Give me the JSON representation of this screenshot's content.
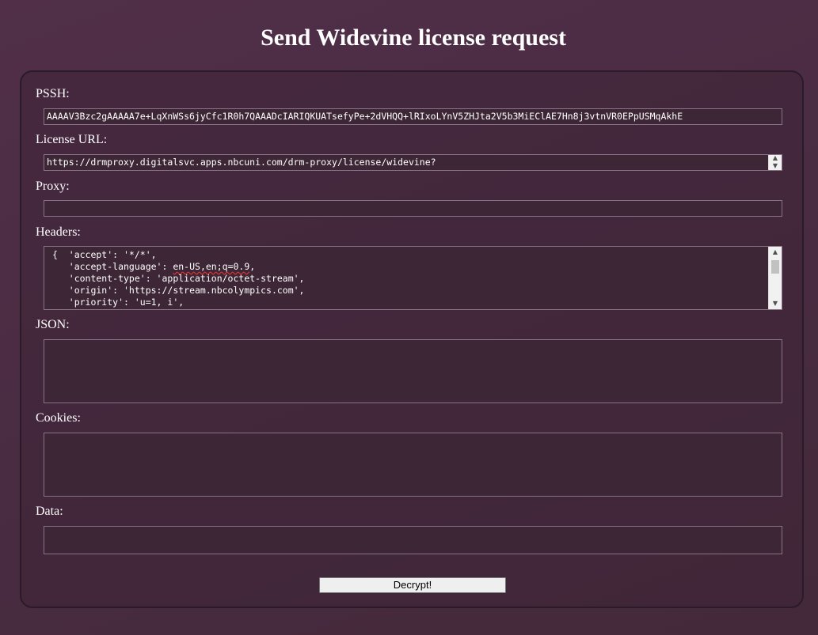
{
  "page": {
    "title": "Send Widevine license request"
  },
  "form": {
    "pssh": {
      "label": "PSSH:",
      "value": "AAAAV3Bzc2gAAAAA7e+LqXnWSs6jyCfc1R0h7QAAADcIARIQKUATsefyPe+2dVHQQ+lRIxoLYnV5ZHJta2V5b3MiEClAE7Hn8j3vtnVR0EPpUSMqAkhE"
    },
    "license_url": {
      "label": "License URL:",
      "value": "https://drmproxy.digitalsvc.apps.nbcuni.com/drm-proxy/license/widevine?"
    },
    "proxy": {
      "label": "Proxy:",
      "value": ""
    },
    "headers": {
      "label": "Headers:",
      "lines": [
        "{  'accept': '*/*',",
        "   'accept-language': ",
        "   'content-type': 'application/octet-stream',",
        "   'origin': 'https://stream.nbcolympics.com',",
        "   'priority': 'u=1, i',"
      ],
      "accept_language_value": "en-US,en;q=0.9",
      "accept_language_tail": ","
    },
    "json": {
      "label": "JSON:",
      "value": ""
    },
    "cookies": {
      "label": "Cookies:",
      "value": ""
    },
    "data": {
      "label": "Data:",
      "value": ""
    },
    "submit_label": "Decrypt!"
  },
  "icons": {
    "scroll_up": "▲",
    "scroll_down": "▼"
  }
}
